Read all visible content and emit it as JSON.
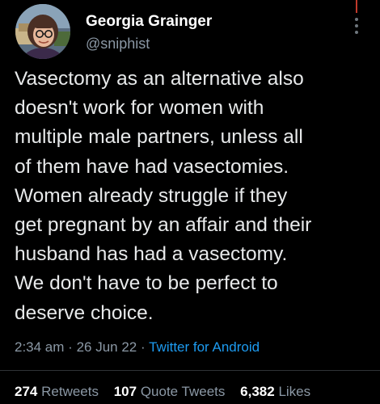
{
  "author": {
    "name": "Georgia Grainger",
    "handle": "@sniphist"
  },
  "tweet": {
    "text": "Vasectomy as an alternative also\ndoesn't work for women with\nmultiple male partners, unless all\nof them have had vasectomies.\nWomen already struggle if they\nget pregnant by an affair and their\nhusband has had a vasectomy.\nWe don't have to be perfect to\ndeserve choice.",
    "time": "2:34 am",
    "sep1": "·",
    "date": "26 Jun 22",
    "sep2": "·",
    "source": "Twitter for Android"
  },
  "stats": {
    "retweets_count": "274",
    "retweets_label": "Retweets",
    "quote_count": "107",
    "quote_label": "Quote Tweets",
    "likes_count": "6,382",
    "likes_label": "Likes"
  },
  "colors": {
    "background": "#000000",
    "text": "#e7e9ea",
    "secondary": "#8b98a5",
    "link": "#1d9bf0"
  },
  "icons": {
    "more": "more-vertical-icon"
  }
}
